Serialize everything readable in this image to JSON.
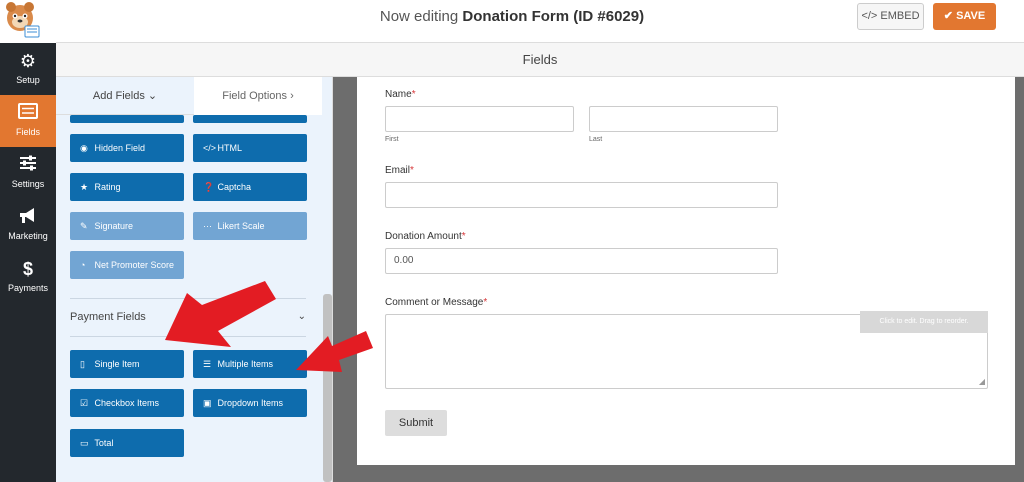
{
  "topbar": {
    "title_prefix": "Now editing",
    "title_form": "Donation Form (ID #6029)",
    "embed_label": "EMBED",
    "save_label": "SAVE"
  },
  "leftnav": {
    "items": [
      {
        "label": "Setup",
        "icon": "gear-icon"
      },
      {
        "label": "Fields",
        "icon": "fields-icon"
      },
      {
        "label": "Settings",
        "icon": "sliders-icon"
      },
      {
        "label": "Marketing",
        "icon": "megaphone-icon"
      },
      {
        "label": "Payments",
        "icon": "dollar-icon"
      }
    ]
  },
  "header": {
    "title": "Fields"
  },
  "panel": {
    "tabs": {
      "add": "Add Fields",
      "options": "Field Options"
    },
    "fancy_fields": [
      {
        "label": "Hidden Field",
        "icon": "eye-icon"
      },
      {
        "label": "HTML",
        "icon": "code-icon"
      },
      {
        "label": "Rating",
        "icon": "star-icon"
      },
      {
        "label": "Captcha",
        "icon": "question-icon"
      },
      {
        "label": "Signature",
        "icon": "pen-icon"
      },
      {
        "label": "Likert Scale",
        "icon": "dots-icon"
      },
      {
        "label": "Net Promoter Score",
        "icon": "gauge-icon"
      }
    ],
    "payment_section": "Payment Fields",
    "payment_fields": [
      {
        "label": "Single Item",
        "icon": "file-icon"
      },
      {
        "label": "Multiple Items",
        "icon": "list-icon"
      },
      {
        "label": "Checkbox Items",
        "icon": "checkbox-icon"
      },
      {
        "label": "Dropdown Items",
        "icon": "dropdown-icon"
      },
      {
        "label": "Total",
        "icon": "money-icon"
      }
    ]
  },
  "form": {
    "name_label": "Name",
    "first_label": "First",
    "last_label": "Last",
    "email_label": "Email",
    "amount_label": "Donation Amount",
    "amount_value": "0.00",
    "comment_label": "Comment or Message",
    "hint": "Click to edit. Drag to reorder.",
    "submit_label": "Submit"
  },
  "colors": {
    "accent": "#e27730",
    "nav_bg": "#23282d",
    "field_button": "#0e6cad",
    "field_button_disabled": "#72a5d3",
    "arrow": "#e31c23"
  }
}
